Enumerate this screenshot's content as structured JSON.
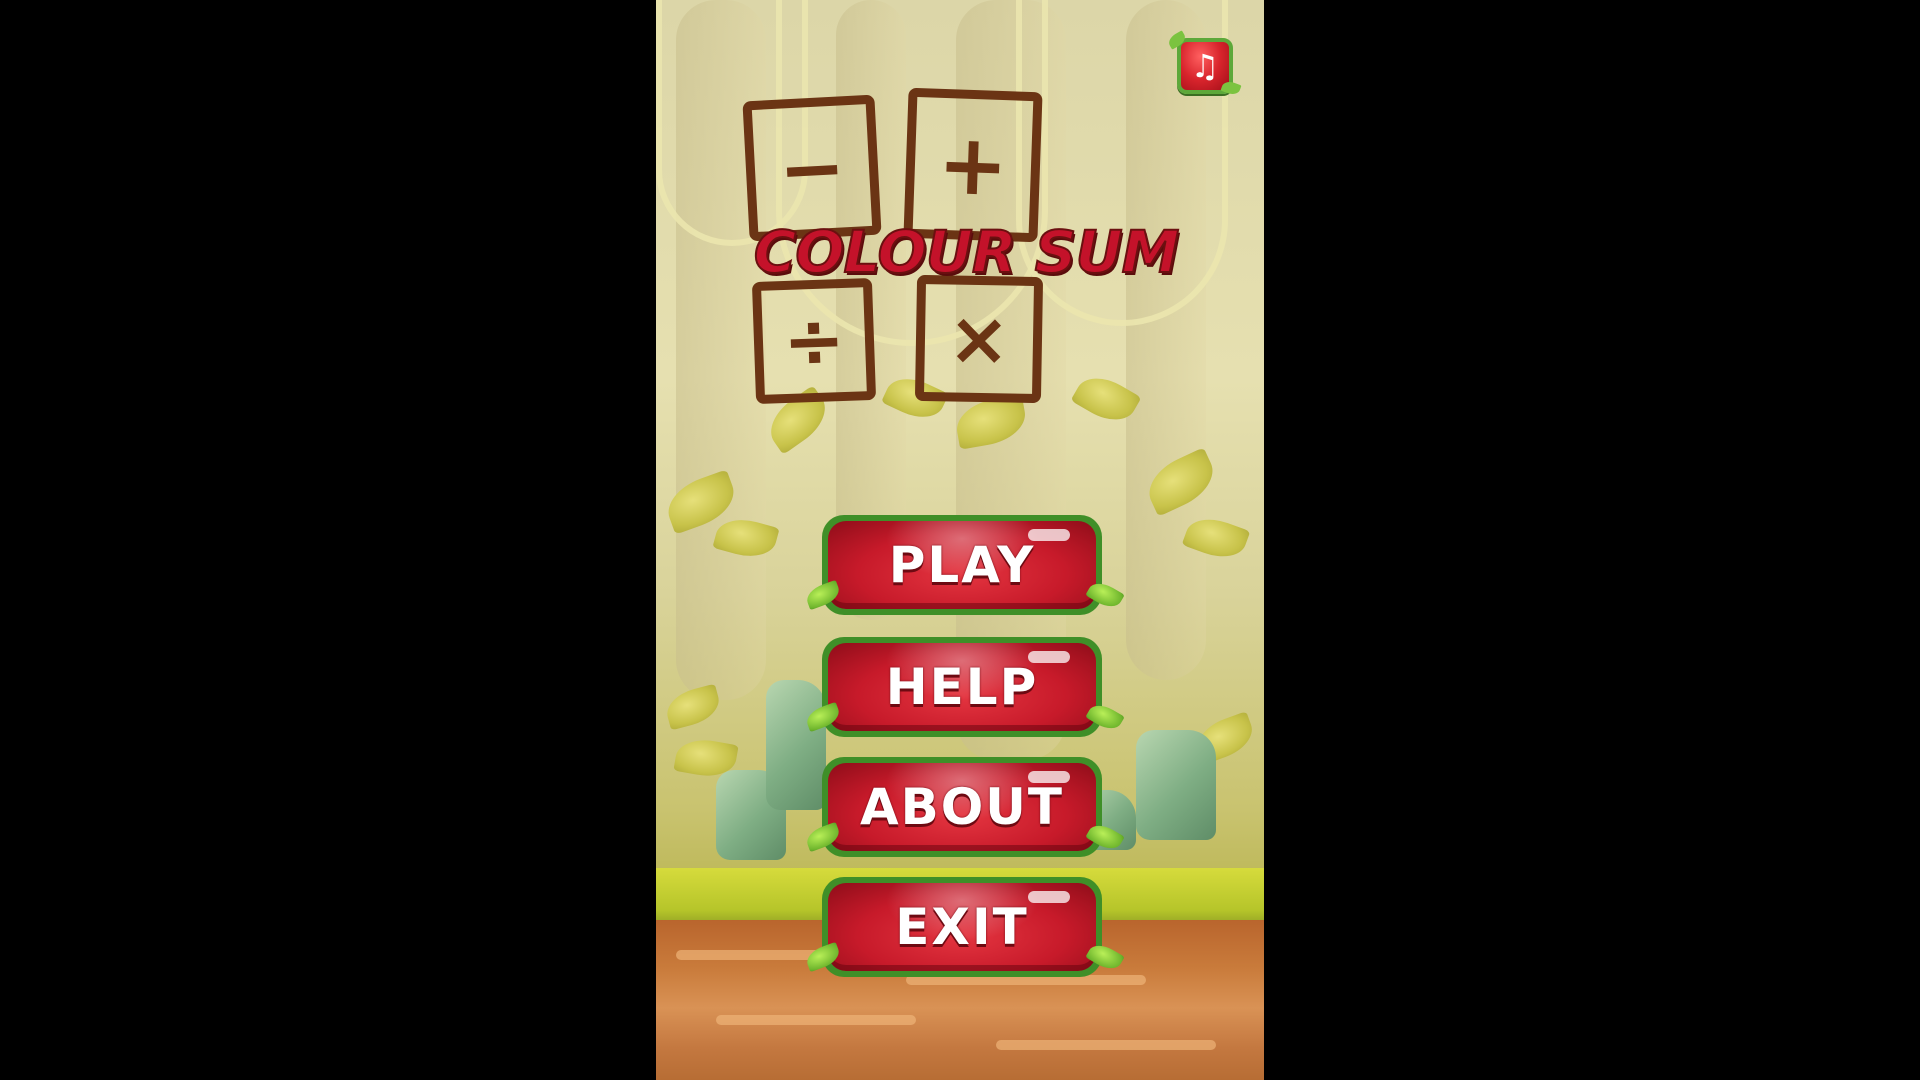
{
  "game": {
    "title_left": "COLOUR",
    "title_right": "SUM",
    "operators": {
      "minus": "−",
      "plus": "+",
      "divide": "÷",
      "multiply": "×"
    }
  },
  "music_button": {
    "icon": "music-note-icon",
    "glyph": "♫"
  },
  "menu": {
    "play": "PLAY",
    "help": "HELP",
    "about": "ABOUT",
    "exit": "EXIT"
  },
  "colors": {
    "button_red": "#c71a2a",
    "button_border_green": "#3f8f28",
    "title_red": "#c4122a",
    "logo_brown": "#6b3414",
    "letterbox": "#000000"
  }
}
